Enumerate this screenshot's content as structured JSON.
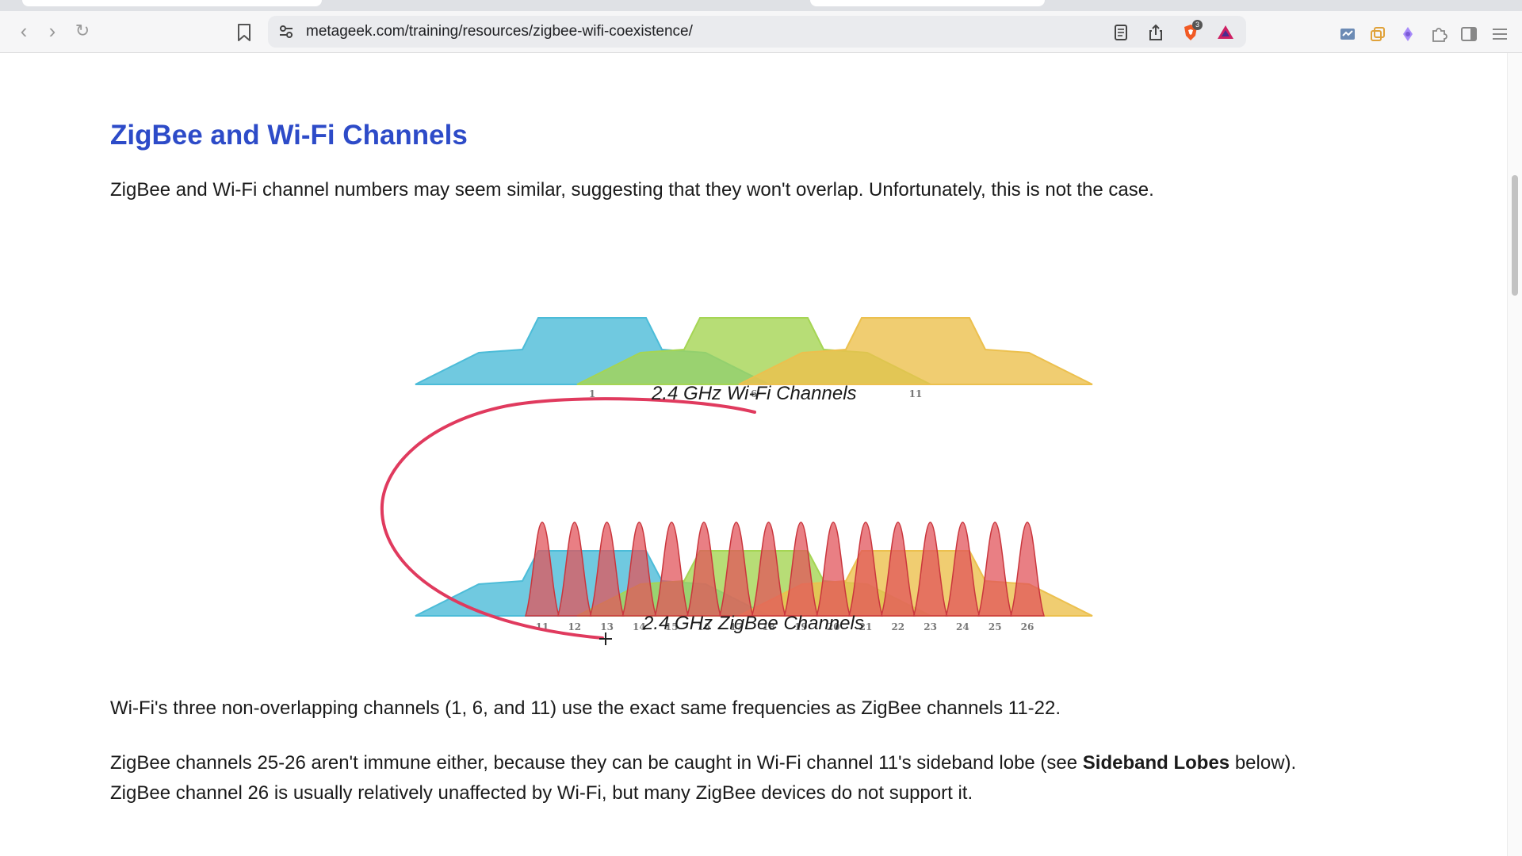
{
  "browser": {
    "url": "metageek.com/training/resources/zigbee-wifi-coexistence/",
    "shield_badge_count": "3"
  },
  "article": {
    "heading": "ZigBee and Wi-Fi Channels",
    "intro": "ZigBee and Wi-Fi channel numbers may seem similar, suggesting that they won't overlap. Unfortunately, this is not the case.",
    "para2": "Wi-Fi's three non-overlapping channels (1, 6, and 11) use the exact same frequencies as ZigBee channels 11-22.",
    "para3_before": "ZigBee channels 25-26 aren't immune either, because they can be caught in Wi-Fi channel 11's sideband lobe (see ",
    "para3_bold": "Sideband Lobes",
    "para3_after": " below).",
    "para4": "ZigBee channel 26 is usually relatively unaffected by Wi-Fi, but many ZigBee devices do not support it."
  },
  "figure": {
    "wifi_caption": "2.4 GHz Wi-Fi Channels",
    "zigbee_caption": "2.4 GHz ZigBee Channels",
    "wifi_channels": [
      {
        "label": "1",
        "color": "#4cbcd8"
      },
      {
        "label": "6",
        "color": "#a5d554"
      },
      {
        "label": "11",
        "color": "#ecc04e"
      }
    ],
    "zigbee_channels": [
      "11",
      "12",
      "13",
      "14",
      "15",
      "16",
      "17",
      "18",
      "19",
      "20",
      "21",
      "22",
      "23",
      "24",
      "25",
      "26"
    ],
    "zigbee_color": "#e2545b",
    "annotation_color": "#e03a5e"
  }
}
